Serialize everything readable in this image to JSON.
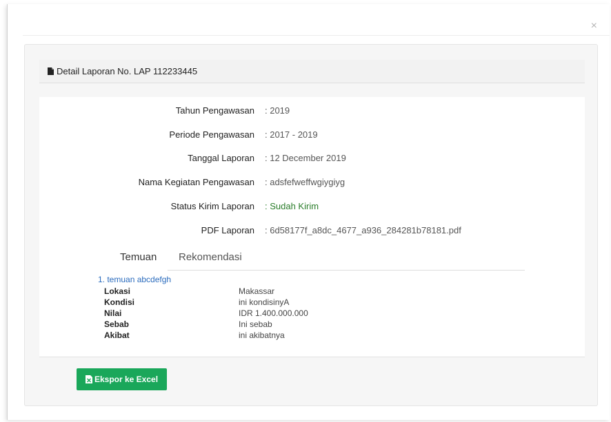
{
  "modal": {
    "close_symbol": "×"
  },
  "detail": {
    "title": "Detail Laporan No. LAP 112233445",
    "icon": "file-icon"
  },
  "info": {
    "tahun": {
      "label": "Tahun Pengawasan",
      "value": ": 2019"
    },
    "periode": {
      "label": "Periode Pengawasan",
      "value": ": 2017 - 2019"
    },
    "tanggal": {
      "label": "Tanggal Laporan",
      "value": ": 12 December 2019"
    },
    "kegiatan": {
      "label": "Nama Kegiatan Pengawasan",
      "value": ": adsfefweffwgiygiyg"
    },
    "status": {
      "label": "Status Kirim Laporan",
      "value": ": Sudah Kirim",
      "color": "#2a7d2a"
    },
    "pdf": {
      "label": "PDF Laporan",
      "value": ": 6d58177f_a8dc_4677_a936_284281b78181.pdf"
    }
  },
  "tabs": {
    "temuan": "Temuan",
    "rekomendasi": "Rekomendasi",
    "active": "Temuan"
  },
  "temuan": {
    "title": "1. temuan abcdefgh",
    "lokasi": {
      "label": "Lokasi",
      "value": "Makassar"
    },
    "kondisi": {
      "label": "Kondisi",
      "value": "ini kondisinyA"
    },
    "nilai": {
      "label": "Nilai",
      "value": "IDR 1.400.000.000"
    },
    "sebab": {
      "label": "Sebab",
      "value": "Ini sebab"
    },
    "akibat": {
      "label": "Akibat",
      "value": "ini akibatnya"
    }
  },
  "export": {
    "label": "Ekspor ke Excel",
    "icon": "excel-file-icon",
    "color": "#1aa75a"
  }
}
